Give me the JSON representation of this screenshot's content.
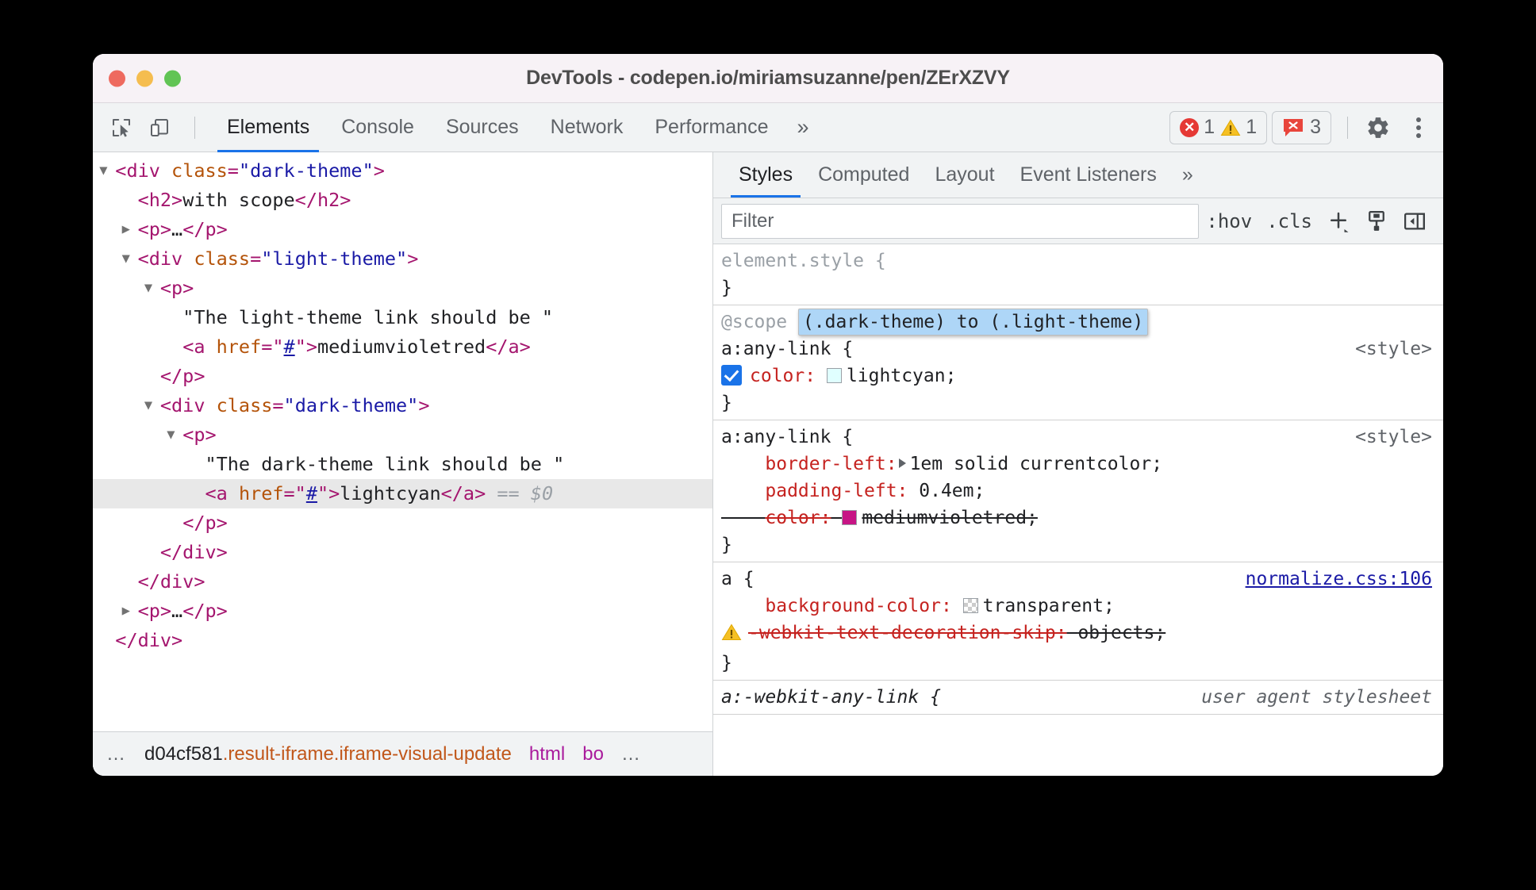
{
  "window": {
    "title": "DevTools - codepen.io/miriamsuzanne/pen/ZErXZVY"
  },
  "toolbar": {
    "icons": [
      "inspect-element-icon",
      "device-toolbar-icon"
    ],
    "tabs": [
      {
        "label": "Elements",
        "active": true
      },
      {
        "label": "Console",
        "active": false
      },
      {
        "label": "Sources",
        "active": false
      },
      {
        "label": "Network",
        "active": false
      },
      {
        "label": "Performance",
        "active": false
      }
    ],
    "more_tabs_glyph": "»",
    "badges": {
      "errors": "1",
      "warnings": "1",
      "issues": "3"
    },
    "settings_label": "gear-icon",
    "menu_label": "kebab-menu-icon"
  },
  "dom_tree": {
    "rows": [
      {
        "indent": 1,
        "toggle": "open",
        "parts": [
          {
            "t": "tagp",
            "s": "<div "
          },
          {
            "t": "attr",
            "s": "class"
          },
          {
            "t": "tagp",
            "s": "="
          },
          {
            "t": "val",
            "s": "\"dark-theme\""
          },
          {
            "t": "tagp",
            "s": ">"
          }
        ]
      },
      {
        "indent": 2,
        "toggle": "none",
        "parts": [
          {
            "t": "tagp",
            "s": "<h2>"
          },
          {
            "t": "txt",
            "s": "with scope"
          },
          {
            "t": "tagp",
            "s": "</h2>"
          }
        ]
      },
      {
        "indent": 2,
        "toggle": "closed",
        "parts": [
          {
            "t": "tagp",
            "s": "<p>"
          },
          {
            "t": "txt",
            "s": "…"
          },
          {
            "t": "tagp",
            "s": "</p>"
          }
        ]
      },
      {
        "indent": 2,
        "toggle": "open",
        "parts": [
          {
            "t": "tagp",
            "s": "<div "
          },
          {
            "t": "attr",
            "s": "class"
          },
          {
            "t": "tagp",
            "s": "="
          },
          {
            "t": "val",
            "s": "\"light-theme\""
          },
          {
            "t": "tagp",
            "s": ">"
          }
        ]
      },
      {
        "indent": 3,
        "toggle": "open",
        "parts": [
          {
            "t": "tagp",
            "s": "<p>"
          }
        ]
      },
      {
        "indent": 4,
        "toggle": "none",
        "parts": [
          {
            "t": "txt",
            "s": "\"The light-theme link should be \""
          }
        ]
      },
      {
        "indent": 4,
        "toggle": "none",
        "parts": [
          {
            "t": "tagp",
            "s": "<a "
          },
          {
            "t": "attr",
            "s": "href"
          },
          {
            "t": "tagp",
            "s": "=\""
          },
          {
            "t": "hash",
            "s": "#"
          },
          {
            "t": "tagp",
            "s": "\">"
          },
          {
            "t": "txt",
            "s": "mediumvioletred"
          },
          {
            "t": "tagp",
            "s": "</a>"
          }
        ]
      },
      {
        "indent": 3,
        "toggle": "none",
        "parts": [
          {
            "t": "tagp",
            "s": "</p>"
          }
        ]
      },
      {
        "indent": 3,
        "toggle": "open",
        "parts": [
          {
            "t": "tagp",
            "s": "<div "
          },
          {
            "t": "attr",
            "s": "class"
          },
          {
            "t": "tagp",
            "s": "="
          },
          {
            "t": "val",
            "s": "\"dark-theme\""
          },
          {
            "t": "tagp",
            "s": ">"
          }
        ]
      },
      {
        "indent": 4,
        "toggle": "open",
        "parts": [
          {
            "t": "tagp",
            "s": "<p>"
          }
        ]
      },
      {
        "indent": 5,
        "toggle": "none",
        "parts": [
          {
            "t": "txt",
            "s": "\"The dark-theme link should be \""
          }
        ]
      },
      {
        "indent": 5,
        "toggle": "none",
        "selected": true,
        "parts": [
          {
            "t": "tagp",
            "s": "<a "
          },
          {
            "t": "attr",
            "s": "href"
          },
          {
            "t": "tagp",
            "s": "=\""
          },
          {
            "t": "hash",
            "s": "#"
          },
          {
            "t": "tagp",
            "s": "\">"
          },
          {
            "t": "txt",
            "s": "lightcyan"
          },
          {
            "t": "tagp",
            "s": "</a>"
          },
          {
            "t": "eq",
            "s": " == "
          },
          {
            "t": "dollar",
            "s": "$0"
          }
        ]
      },
      {
        "indent": 4,
        "toggle": "none",
        "parts": [
          {
            "t": "tagp",
            "s": "</p>"
          }
        ]
      },
      {
        "indent": 3,
        "toggle": "none",
        "parts": [
          {
            "t": "tagp",
            "s": "</div>"
          }
        ]
      },
      {
        "indent": 2,
        "toggle": "none",
        "parts": [
          {
            "t": "tagp",
            "s": "</div>"
          }
        ]
      },
      {
        "indent": 2,
        "toggle": "closed",
        "parts": [
          {
            "t": "tagp",
            "s": "<p>"
          },
          {
            "t": "txt",
            "s": "…"
          },
          {
            "t": "tagp",
            "s": "</p>"
          }
        ]
      },
      {
        "indent": 1,
        "toggle": "none",
        "parts": [
          {
            "t": "tagp",
            "s": "</div>"
          }
        ]
      }
    ]
  },
  "breadcrumb": {
    "leading_ellipsis": "…",
    "items": [
      {
        "id": "d04cf581",
        "classes": ".result-iframe.iframe-visual-update"
      },
      {
        "tag": "html"
      },
      {
        "tag": "bo"
      }
    ],
    "trailing_ellipsis": "…"
  },
  "styles": {
    "tabs": [
      {
        "label": "Styles",
        "active": true
      },
      {
        "label": "Computed",
        "active": false
      },
      {
        "label": "Layout",
        "active": false
      },
      {
        "label": "Event Listeners",
        "active": false
      }
    ],
    "more_tabs_glyph": "»",
    "filter_placeholder": "Filter",
    "filter_value": "",
    "buttons": [
      ":hov",
      ".cls"
    ],
    "icons": [
      "new-style-rule-icon",
      "element-classes-icon",
      "toggle-sidebar-icon"
    ],
    "rules": [
      {
        "name": "element-style-rule",
        "selector": "element.style {",
        "selector_muted": true,
        "origin": "",
        "declarations": [],
        "close": "}"
      },
      {
        "name": "scope-rule",
        "at_rule_prefix": "@scope",
        "at_rule_highlight": "(.dark-theme) to (.light-theme)",
        "selector": "a:any-link {",
        "origin": "<style>",
        "declarations": [
          {
            "checkbox": true,
            "property": "color",
            "value": "lightcyan",
            "swatch": "lightcyan",
            "struck": false
          }
        ],
        "close": "}"
      },
      {
        "name": "a-any-link-rule",
        "selector": "a:any-link {",
        "origin": "<style>",
        "declarations": [
          {
            "property": "border-left",
            "value": "1em solid currentcolor",
            "expandable": true,
            "struck": false
          },
          {
            "property": "padding-left",
            "value": "0.4em",
            "struck": false
          },
          {
            "property": "color",
            "value": "mediumvioletred",
            "swatch": "mediumvioletred",
            "struck": true
          }
        ],
        "close": "}"
      },
      {
        "name": "normalize-a-rule",
        "selector": "a {",
        "origin": "normalize.css:106",
        "origin_is_link": true,
        "declarations": [
          {
            "property": "background-color",
            "value": "transparent",
            "swatch": "transparent",
            "struck": false
          },
          {
            "property": "-webkit-text-decoration-skip",
            "value": "objects",
            "struck": true,
            "warning": true
          }
        ],
        "close": "}"
      },
      {
        "name": "user-agent-rule",
        "selector": "a:-webkit-any-link {",
        "origin": "user agent stylesheet",
        "origin_is_ua": true,
        "italic": true,
        "declarations": [],
        "close": ""
      }
    ]
  },
  "colors": {
    "accent": "#1a73e8",
    "error": "#e53935",
    "warning": "#f5b400",
    "issue": "#e8453c",
    "property": "#c5221f",
    "tag": "#a91b9c",
    "attr": "#b45309",
    "attr_value": "#1a1aa6",
    "selection": "#aed6f7",
    "mediumvioletred": "#c71585",
    "lightcyan": "#e0ffff"
  }
}
